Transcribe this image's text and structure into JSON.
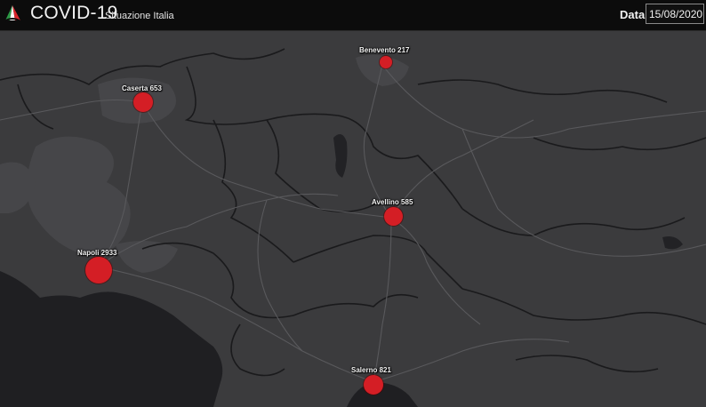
{
  "header": {
    "title": "COVID-19",
    "subtitle": "Situazione Italia",
    "date_label": "Data",
    "date_value": "15/08/2020",
    "logo_icon": "italy-tricolor-triangle-logo"
  },
  "colors": {
    "land": "#3b3b3d",
    "sea": "#1f1f22",
    "marker": "#d41e25",
    "header_bg": "#0c0c0c"
  },
  "map": {
    "markers": [
      {
        "name": "Benevento",
        "count": "217",
        "label": "Benevento 217"
      },
      {
        "name": "Caserta",
        "count": "653",
        "label": "Caserta 653"
      },
      {
        "name": "Avellino",
        "count": "585",
        "label": "Avellino 585"
      },
      {
        "name": "Napoli",
        "count": "2933",
        "label": "Napoli 2933"
      },
      {
        "name": "Salerno",
        "count": "821",
        "label": "Salerno 821"
      }
    ]
  }
}
